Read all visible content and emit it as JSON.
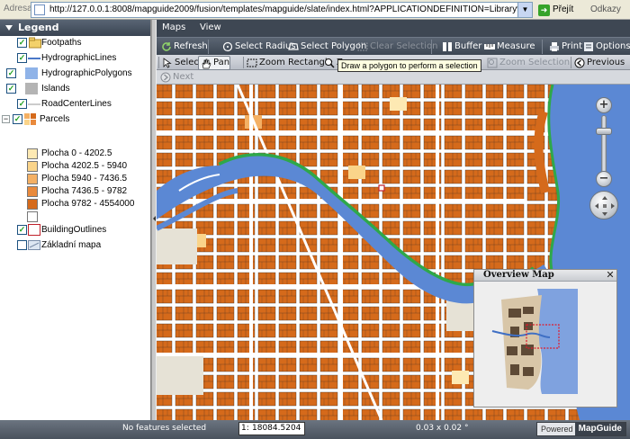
{
  "browser": {
    "address_label": "Adresa",
    "url": "http://127.0.0.1:8008/mapguide2009/fusion/templates/mapguide/slate/index.html?APPLICATIONDEFINITION=Library%3a%2f%2fTestovaci_",
    "go_label": "Přejít",
    "links_label": "Odkazy"
  },
  "legend": {
    "title": "Legend",
    "layers": [
      {
        "label": "Footpaths",
        "checked": true
      },
      {
        "label": "HydrographicLines",
        "checked": true
      },
      {
        "label": "HydrographicPolygons",
        "checked": true
      },
      {
        "label": "Islands",
        "checked": true
      },
      {
        "label": "RoadCenterLines",
        "checked": true
      },
      {
        "label": "Parcels",
        "checked": true
      },
      {
        "label": "BuildingOutlines",
        "checked": true
      },
      {
        "label": "Základní mapa",
        "checked": false
      }
    ],
    "parcel_classes": [
      {
        "label": "Plocha 0 - 4202.5",
        "color": "#fde9b3"
      },
      {
        "label": "Plocha 4202.5 - 5940",
        "color": "#fad48a"
      },
      {
        "label": "Plocha 5940 - 7436.5",
        "color": "#f4b064"
      },
      {
        "label": "Plocha 7436.5 - 9782",
        "color": "#e98a3c"
      },
      {
        "label": "Plocha 9782 - 4554000",
        "color": "#d56a1b"
      },
      {
        "label": "",
        "color": "#ffffff"
      }
    ]
  },
  "menu": {
    "maps": "Maps",
    "view": "View"
  },
  "toolbar1": {
    "refresh": "Refresh",
    "select_radius": "Select Radius",
    "select_polygon": "Select Polygon",
    "clear_selection": "Clear Selection",
    "buffer": "Buffer",
    "measure": "Measure",
    "print": "Print",
    "options": "Options"
  },
  "toolbar2": {
    "select": "Select",
    "pan": "Pan",
    "zoom_rectangle": "Zoom Rectangle",
    "zoom_in_partial": "Z",
    "zoom_selection": "Zoom Selection",
    "previous": "Previous"
  },
  "toolbar3": {
    "next": "Next"
  },
  "tooltip": "Draw a polygon to perform a selection",
  "overview": {
    "title": "Overview Map"
  },
  "status": {
    "features": "No features selected",
    "scale_prefix": "1:",
    "scale": "18084.5204",
    "size": "0.03 x 0.02 °",
    "powered_by": "Powered by",
    "brand": "MapGuide"
  },
  "colors": {
    "parcel": "#d56a1b",
    "road": "#ffffff",
    "water": "#5b88d4",
    "shore": "#2ea84a",
    "chrome": "#3e4753"
  }
}
